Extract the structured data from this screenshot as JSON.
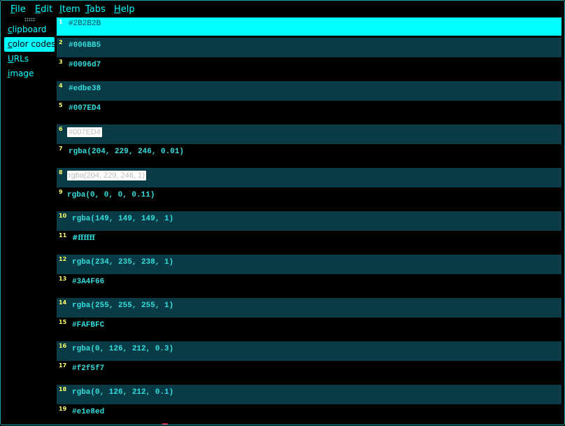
{
  "menu": [
    {
      "label": "File",
      "accel": "F",
      "rest": "ile"
    },
    {
      "label": "Edit",
      "accel": "E",
      "rest": "dit"
    },
    {
      "label": "Item",
      "accel": "I",
      "rest": "tem"
    },
    {
      "label": "Tabs",
      "accel": "T",
      "rest": "abs"
    },
    {
      "label": "Help",
      "accel": "H",
      "rest": "elp"
    }
  ],
  "tabs": [
    {
      "label": "clipboard",
      "accel": "c",
      "rest": "lipboard",
      "active": false
    },
    {
      "label": "color codes",
      "accel": "c",
      "rest": "olor codes",
      "active": true
    },
    {
      "label": "URLs",
      "accel": "U",
      "rest": "RLs",
      "active": false
    },
    {
      "label": "image",
      "accel": "i",
      "rest": "mage",
      "active": false
    }
  ],
  "items": [
    {
      "n": "1",
      "text": "#2B2B2B"
    },
    {
      "n": "2",
      "text": "#006BB5"
    },
    {
      "n": "3",
      "text": "#0096d7"
    },
    {
      "n": "4",
      "text": "#edbe38"
    },
    {
      "n": "5",
      "text": "#007ED4"
    },
    {
      "n": "6",
      "text": "#007ED4"
    },
    {
      "n": "7",
      "text": "rgba(204, 229, 246, 0.01)"
    },
    {
      "n": "8",
      "text": "rgba(204, 229, 246, 1)"
    },
    {
      "n": "9",
      "text": "rgba(0, 0, 0, 0.11)"
    },
    {
      "n": "10",
      "text": "rgba(149, 149, 149, 1)"
    },
    {
      "n": "11",
      "text": "#ffffff"
    },
    {
      "n": "12",
      "text": "rgba(234, 235, 238, 1)"
    },
    {
      "n": "13",
      "text": "#3A4F66"
    },
    {
      "n": "14",
      "text": "rgba(255, 255, 255, 1)"
    },
    {
      "n": "15",
      "text": "#FAFBFC"
    },
    {
      "n": "16",
      "text": "rgba(0, 126, 212, 0.3)"
    },
    {
      "n": "17",
      "text": "#f2f5f7"
    },
    {
      "n": "18",
      "text": "rgba(0, 126, 212, 0.1)"
    },
    {
      "n": "19",
      "text": "#e1e8ed"
    }
  ],
  "colors": {
    "accent": "#00ffff",
    "row_alt": "#083b45",
    "number": "#ffff66",
    "background": "#000000"
  }
}
